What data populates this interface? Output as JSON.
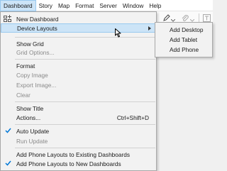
{
  "menubar": {
    "items": [
      "Dashboard",
      "Story",
      "Map",
      "Format",
      "Server",
      "Window",
      "Help"
    ]
  },
  "toolbar": {
    "icons": [
      "pen-icon",
      "paperclip-icon",
      "text-icon"
    ]
  },
  "menu": {
    "new_dashboard": "New Dashboard",
    "device_layouts": "Device Layouts",
    "show_grid": "Show Grid",
    "grid_options": "Grid Options...",
    "format": "Format",
    "copy_image": "Copy Image",
    "export_image": "Export Image...",
    "clear": "Clear",
    "show_title": "Show Title",
    "actions": "Actions...",
    "actions_shortcut": "Ctrl+Shift+D",
    "auto_update": "Auto Update",
    "run_update": "Run Update",
    "add_phone_existing": "Add Phone Layouts to Existing Dashboards",
    "add_phone_new": "Add Phone Layouts to New Dashboards"
  },
  "submenu": {
    "add_desktop": "Add Desktop",
    "add_tablet": "Add Tablet",
    "add_phone": "Add Phone"
  },
  "colors": {
    "highlight": "#cce4f7",
    "highlight_border": "#99c9ef",
    "check": "#0078d7",
    "disabled_text": "#8a8a8a"
  }
}
